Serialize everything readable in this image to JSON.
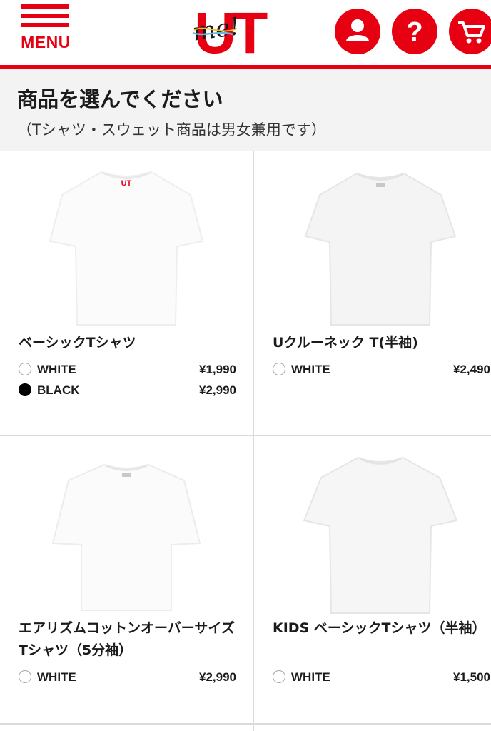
{
  "header": {
    "menu_label": "MENU",
    "logo_main": "UT",
    "logo_script": "me!",
    "brand_color": "#e60012",
    "icons": [
      "account-icon",
      "help-icon",
      "cart-icon"
    ]
  },
  "page": {
    "title": "商品を選んでください",
    "subtitle": "（Tシャツ・スウェット商品は男女兼用です）"
  },
  "products": [
    {
      "name": "ベーシックTシャツ",
      "variants": [
        {
          "color": "WHITE",
          "price": "¥1,990",
          "selected": false
        },
        {
          "color": "BLACK",
          "price": "¥2,990",
          "selected": true
        }
      ]
    },
    {
      "name": "Uクルーネック T(半袖)",
      "variants": [
        {
          "color": "WHITE",
          "price": "¥2,490",
          "selected": false
        }
      ]
    },
    {
      "name": "エアリズムコットンオーバーサイズTシャツ（5分袖）",
      "variants": [
        {
          "color": "WHITE",
          "price": "¥2,990",
          "selected": false
        }
      ]
    },
    {
      "name": "KIDS ベーシックTシャツ（半袖）",
      "variants": [
        {
          "color": "WHITE",
          "price": "¥1,500",
          "selected": false
        }
      ]
    }
  ]
}
